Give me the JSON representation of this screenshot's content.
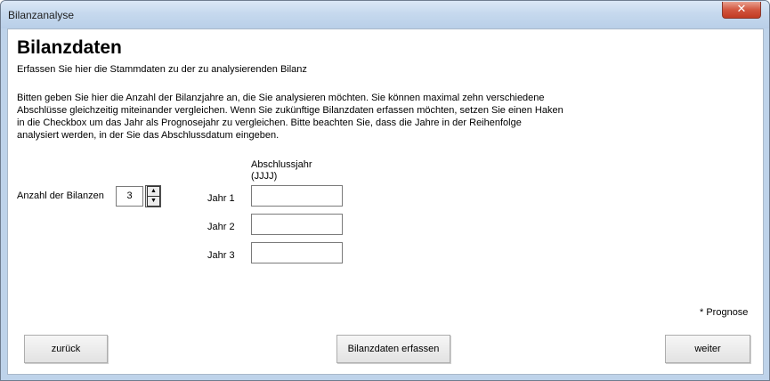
{
  "window": {
    "title": "Bilanzanalyse",
    "close_glyph": "✕"
  },
  "main": {
    "heading": "Bilanzdaten",
    "subtitle": "Erfassen Sie hier die Stammdaten zu der zu analysierenden Bilanz",
    "instructions": [
      "Bitten geben Sie hier die Anzahl der Bilanzjahre an, die Sie analysieren möchten. Sie können maximal zehn verschiedene",
      "Abschlüsse gleichzeitig miteinander vergleichen. Wenn Sie zukünftige Bilanzdaten erfassen möchten, setzen Sie einen Haken",
      "in die Checkbox um das Jahr als Prognosejahr zu vergleichen. Bitte beachten Sie, dass die Jahre in der Reihenfolge",
      "analysiert werden, in der Sie das Abschlussdatum eingeben."
    ]
  },
  "count": {
    "label": "Anzahl der Bilanzen",
    "value": "3",
    "up_glyph": "▲",
    "down_glyph": "▼"
  },
  "years": {
    "header_line1": "Abschlussjahr",
    "header_line2": "(JJJJ)",
    "rows": [
      {
        "label": "Jahr 1",
        "value": ""
      },
      {
        "label": "Jahr 2",
        "value": ""
      },
      {
        "label": "Jahr 3",
        "value": ""
      }
    ]
  },
  "footnote": "* Prognose",
  "buttons": {
    "back": "zurück",
    "capture": "Bilanzdaten erfassen",
    "next": "weiter"
  }
}
